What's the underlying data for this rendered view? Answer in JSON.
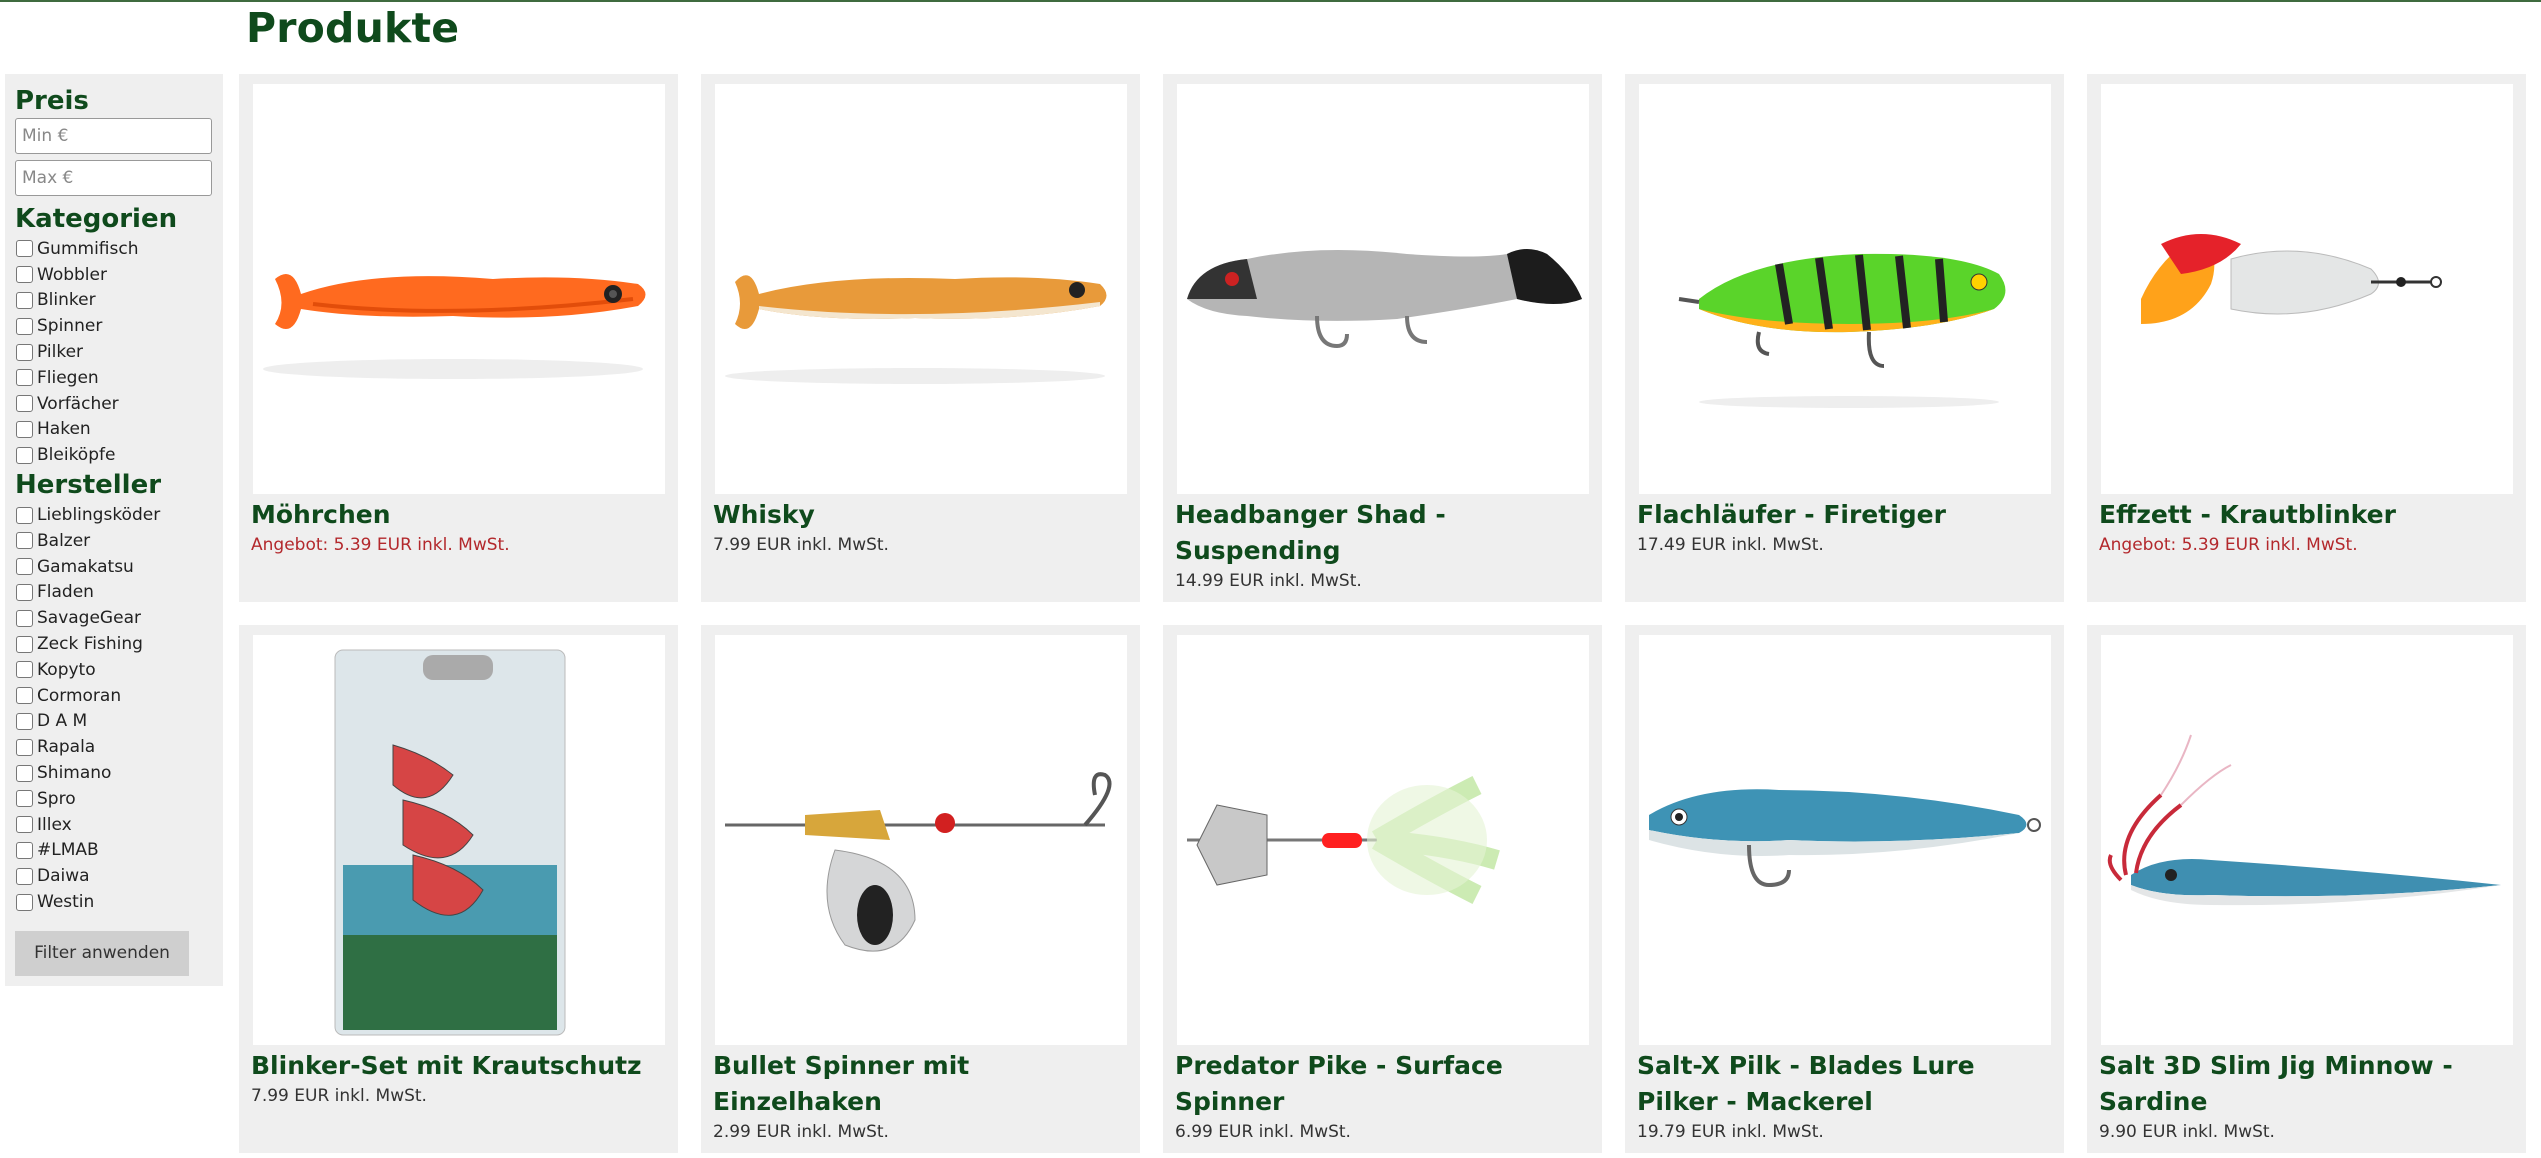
{
  "page": {
    "title": "Produkte"
  },
  "filters": {
    "price_heading": "Preis",
    "min_placeholder": "Min €",
    "max_placeholder": "Max €",
    "categories_heading": "Kategorien",
    "categories": [
      "Gummifisch",
      "Wobbler",
      "Blinker",
      "Spinner",
      "Pilker",
      "Fliegen",
      "Vorfächer",
      "Haken",
      "Bleiköpfe"
    ],
    "manufacturers_heading": "Hersteller",
    "manufacturers": [
      "Lieblingsköder",
      "Balzer",
      "Gamakatsu",
      "Fladen",
      "SavageGear",
      "Zeck Fishing",
      "Kopyto",
      "Cormoran",
      "D A M",
      "Rapala",
      "Shimano",
      "Spro",
      "Illex",
      "#LMAB",
      "Daiwa",
      "Westin"
    ],
    "apply_label": "Filter anwenden"
  },
  "products": [
    {
      "title": "Möhrchen",
      "price": "Angebot: 5.39 EUR inkl. MwSt.",
      "sale": true,
      "image_icon": "orange-shad-lure"
    },
    {
      "title": "Whisky",
      "price": "7.99 EUR inkl. MwSt.",
      "sale": false,
      "image_icon": "amber-shad-lure"
    },
    {
      "title": "Headbanger Shad - Suspending",
      "price": "14.99 EUR inkl. MwSt.",
      "sale": false,
      "image_icon": "black-silver-shad-lure"
    },
    {
      "title": "Flachläufer - Firetiger",
      "price": "17.49 EUR inkl. MwSt.",
      "sale": false,
      "image_icon": "firetiger-wobbler"
    },
    {
      "title": "Effzett - Krautblinker",
      "price": "Angebot: 5.39 EUR inkl. MwSt.",
      "sale": true,
      "image_icon": "krautblinker-spoon"
    },
    {
      "title": "Blinker-Set mit Krautschutz",
      "price": "7.99 EUR inkl. MwSt.",
      "sale": false,
      "image_icon": "blinker-set-package"
    },
    {
      "title": "Bullet Spinner mit Einzelhaken",
      "price": "2.99 EUR inkl. MwSt.",
      "sale": false,
      "image_icon": "bullet-spinner"
    },
    {
      "title": "Predator Pike - Surface Spinner",
      "price": "6.99 EUR inkl. MwSt.",
      "sale": false,
      "image_icon": "surface-spinner"
    },
    {
      "title": "Salt-X Pilk - Blades Lure Pilker - Mackerel",
      "price": "19.79 EUR inkl. MwSt.",
      "sale": false,
      "image_icon": "blade-pilker"
    },
    {
      "title": "Salt 3D Slim Jig Minnow - Sardine",
      "price": "9.90 EUR inkl. MwSt.",
      "sale": false,
      "image_icon": "slim-jig-minnow"
    }
  ],
  "colors": {
    "accent": "#0f4a1c",
    "sale": "#b3282c",
    "panel": "#efefef"
  }
}
